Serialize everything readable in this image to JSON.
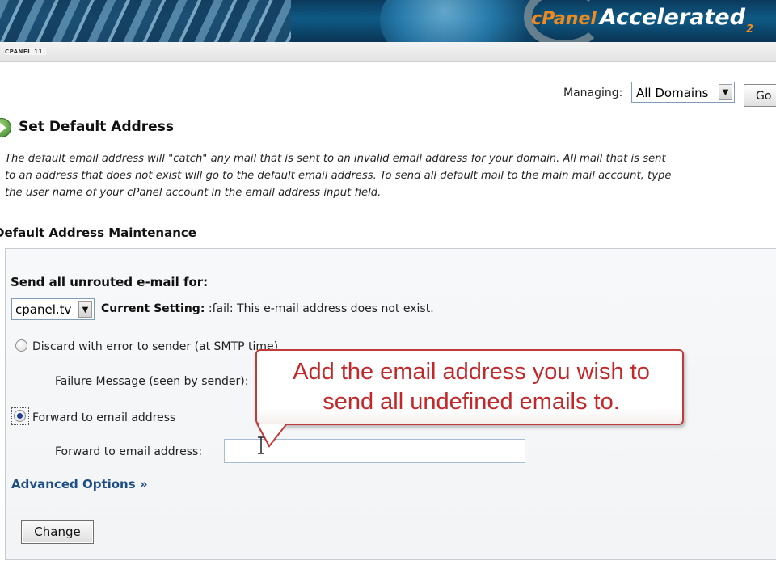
{
  "brand": {
    "name": "cPanel",
    "tagline": "Accelerated",
    "version_mark": "2"
  },
  "version_label": "CPANEL 11",
  "managing": {
    "label": "Managing:",
    "selected": "All Domains",
    "go_label": "Go"
  },
  "page": {
    "title": "Set Default Address",
    "description": [
      "The default email address will \"catch\" any mail that is sent to an invalid email address for your domain. All mail that is sent",
      "to an address that does not exist will go to the default email address. To send all default mail to the main mail account, type",
      "the user name of your cPanel account in the email address input field."
    ]
  },
  "section": {
    "title": "Default Address Maintenance",
    "unrouted_label": "Send all unrouted e-mail for:",
    "domain_selected": "cpanel.tv",
    "current_setting_label": "Current Setting:",
    "current_setting_value": ":fail: This e-mail address does not exist.",
    "options": {
      "discard_label": "Discard with error to sender (at SMTP time)",
      "failure_message_label": "Failure Message (seen by sender):",
      "forward_label": "Forward to email address",
      "forward_field_label": "Forward to email address:",
      "forward_value": "",
      "selected": "forward"
    },
    "advanced_options": "Advanced Options »",
    "change_button": "Change"
  },
  "callout": {
    "line1": "Add the email address you wish to",
    "line2": "send all undefined emails to."
  },
  "colors": {
    "banner_blue": "#0f5a86",
    "brand_orange": "#f08a1c",
    "link_blue": "#1d4f86",
    "callout_red": "#c23a3a"
  }
}
